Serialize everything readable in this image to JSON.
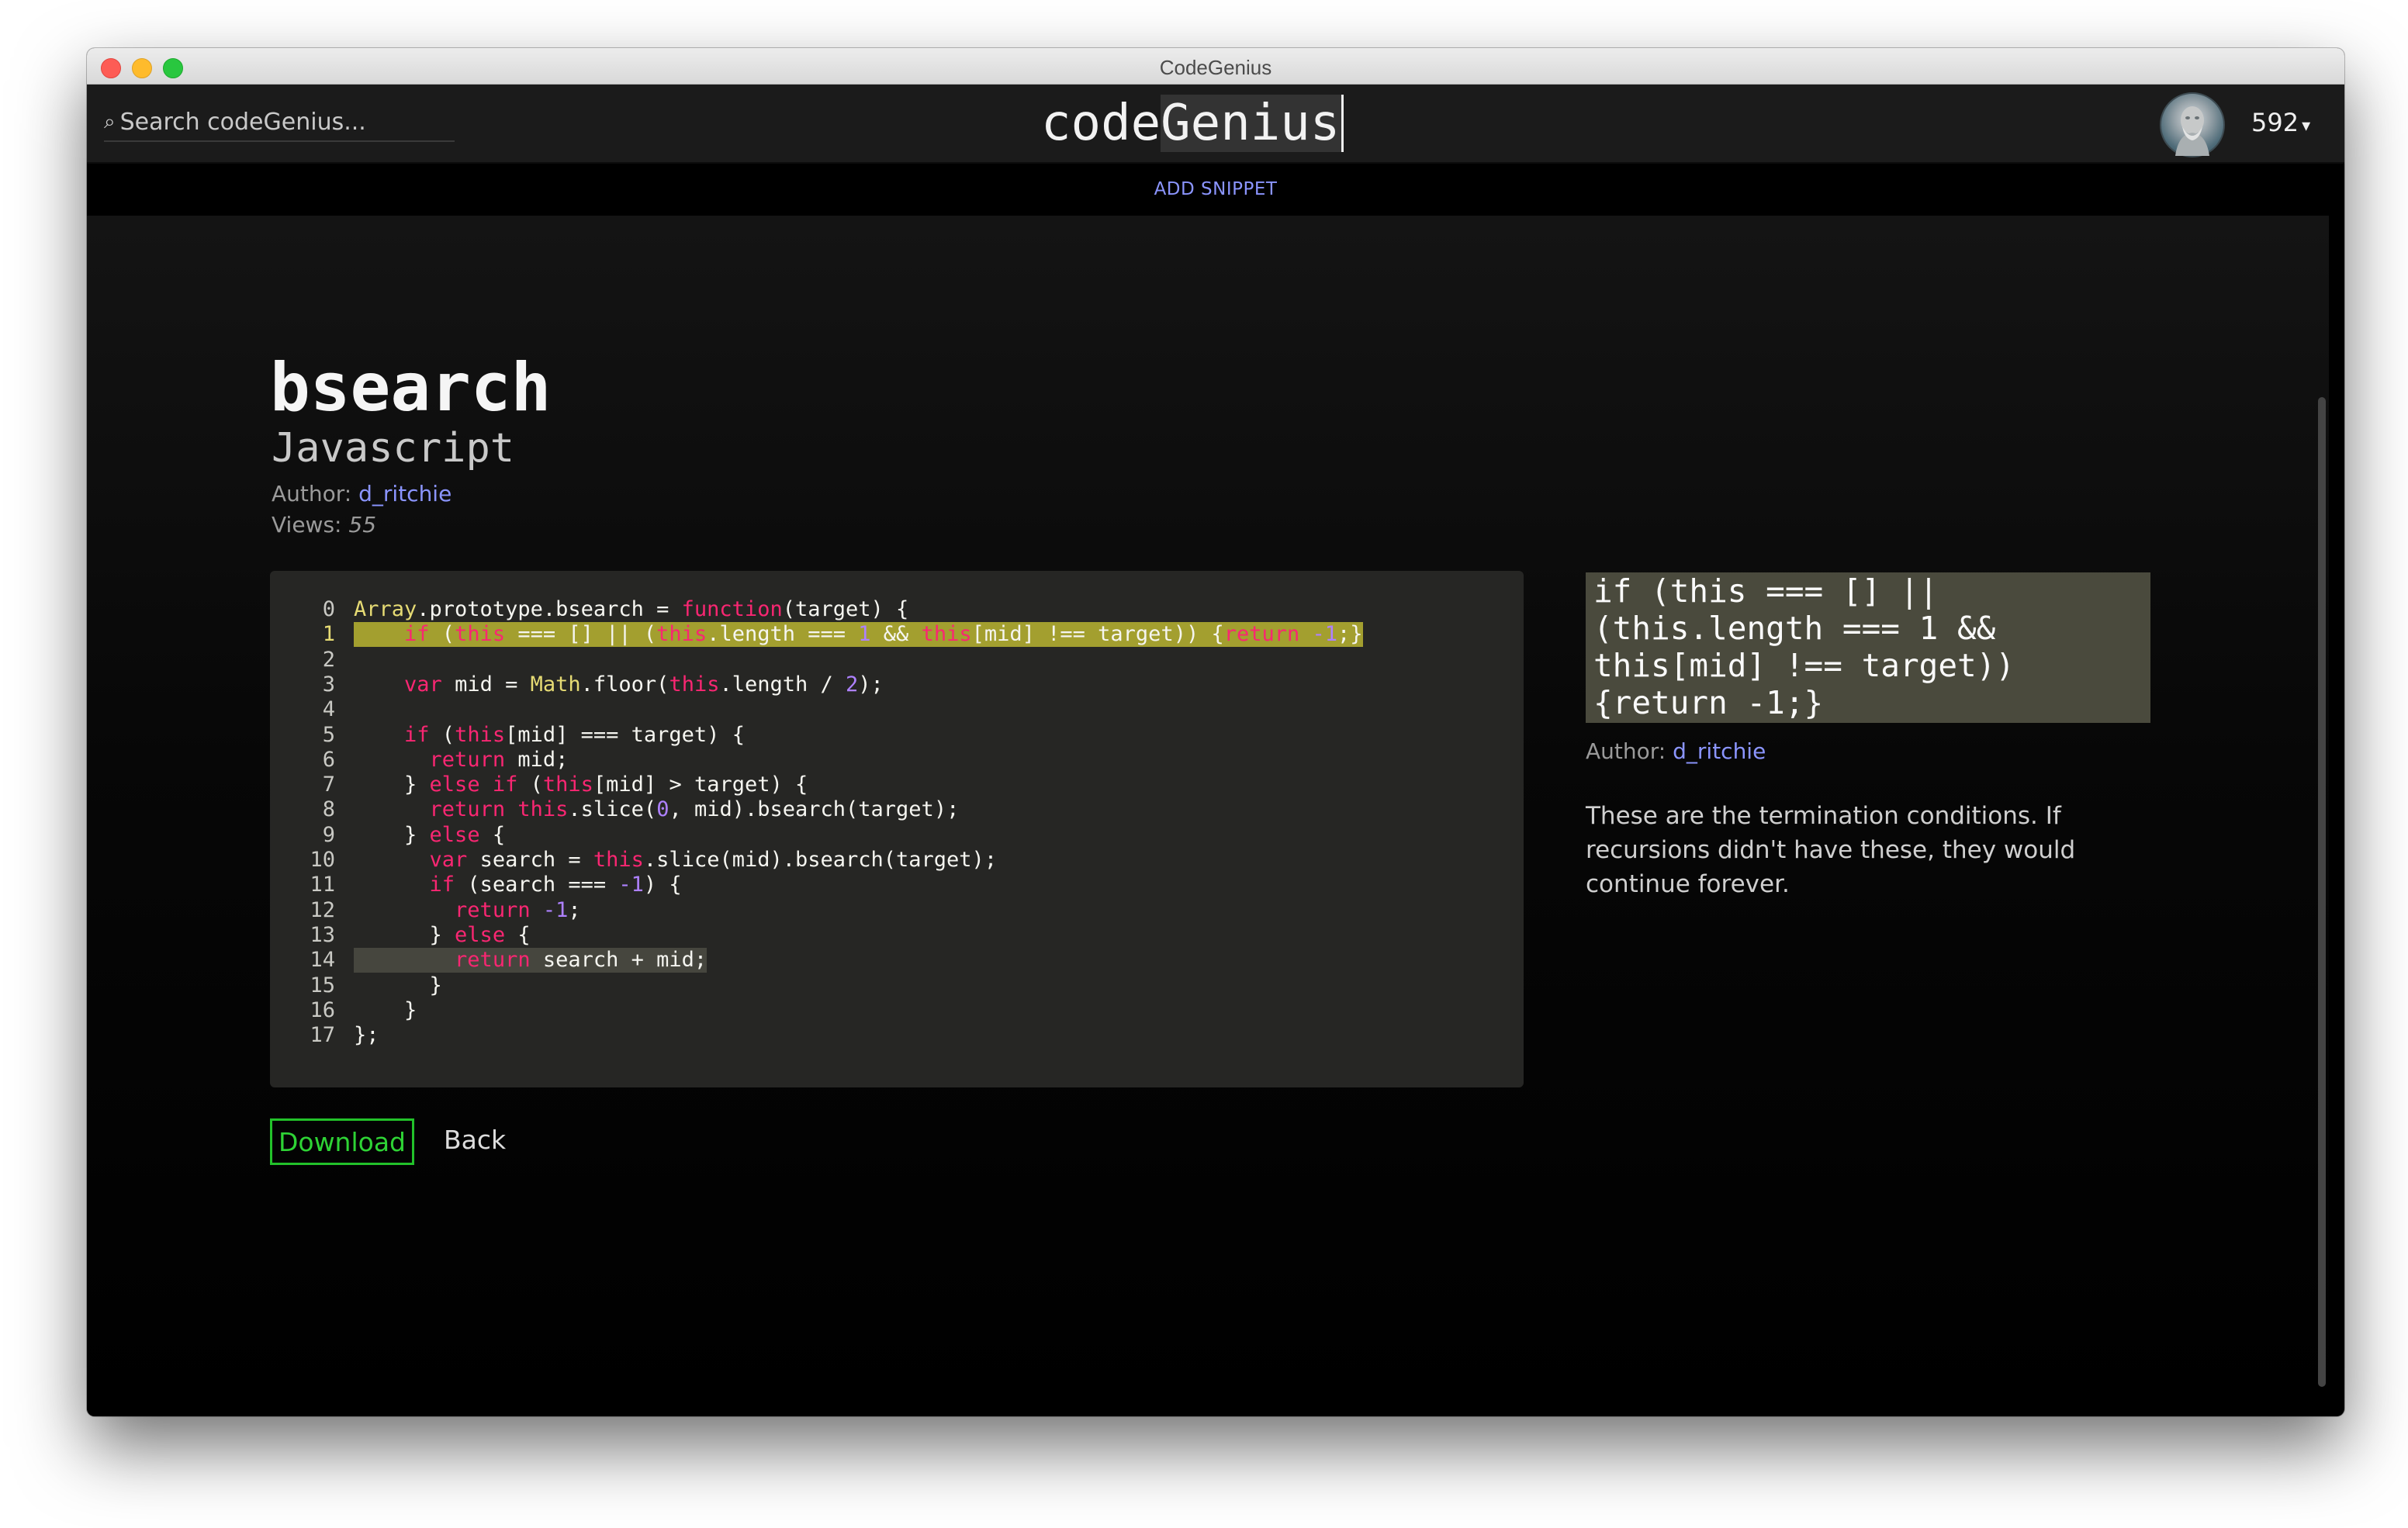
{
  "window": {
    "title": "CodeGenius"
  },
  "header": {
    "search_placeholder": "Search codeGenius...",
    "logo_code": "code",
    "logo_genius": "Genius",
    "points": "592"
  },
  "nav": {
    "add_snippet": "ADD SNIPPET"
  },
  "snippet": {
    "title": "bsearch",
    "language": "Javascript",
    "author_label": "Author:",
    "author": "d_ritchie",
    "views_label": "Views:",
    "views": "55",
    "highlighted_lines": [
      1,
      14
    ],
    "lines": [
      "Array.prototype.bsearch = function(target) {",
      "    if (this === [] || (this.length === 1 && this[mid] !== target)) {return -1;}",
      "",
      "    var mid = Math.floor(this.length / 2);",
      "",
      "    if (this[mid] === target) {",
      "      return mid;",
      "    } else if (this[mid] > target) {",
      "      return this.slice(0, mid).bsearch(target);",
      "    } else {",
      "      var search = this.slice(mid).bsearch(target);",
      "      if (search === -1) {",
      "        return -1;",
      "      } else {",
      "        return search + mid;",
      "      }",
      "    }",
      "};"
    ],
    "download_label": "Download",
    "back_label": "Back"
  },
  "annotation": {
    "code": "if (this === [] ||\n(this.length === 1 &&\nthis[mid] !== target))\n{return -1;}",
    "author_label": "Author:",
    "author": "d_ritchie",
    "text": "These are the termination conditions. If recursions didn't have these, they would continue forever."
  },
  "colors": {
    "link": "#8b95ff",
    "download_green": "#22c22a",
    "highlight_annotated": "#a39f2f",
    "highlight_selected": "#46463e",
    "keyword": "#f92672",
    "number": "#ae81ff"
  }
}
